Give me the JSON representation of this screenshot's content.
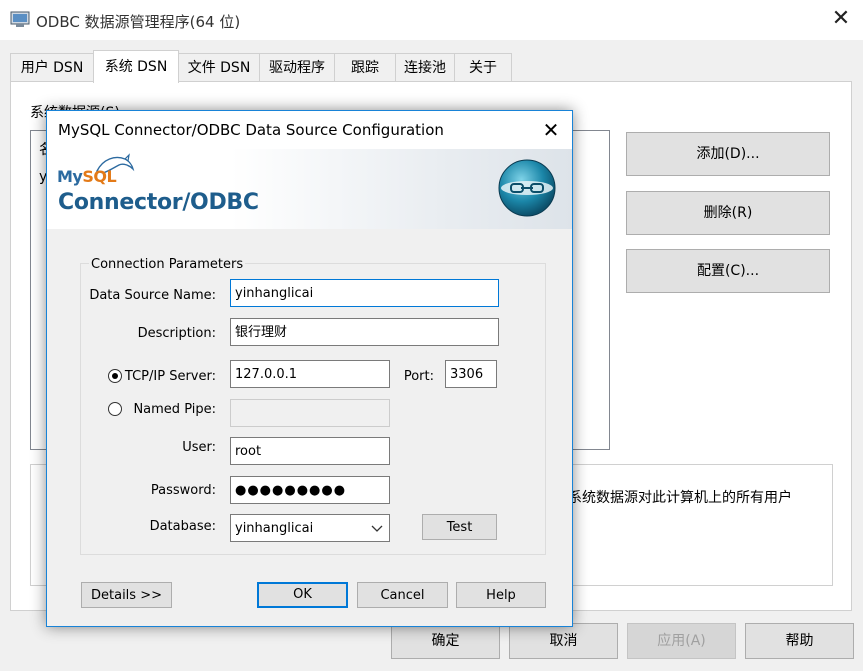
{
  "odbc": {
    "title": "ODBC 数据源管理程序(64 位)",
    "close_glyph": "✕",
    "tabs": [
      {
        "label": "用户 DSN"
      },
      {
        "label": "系统 DSN"
      },
      {
        "label": "文件 DSN"
      },
      {
        "label": "驱动程序"
      },
      {
        "label": "跟踪"
      },
      {
        "label": "连接池"
      },
      {
        "label": "关于"
      }
    ],
    "list_label": "系统数据源(S)",
    "list_fragments": [
      "名",
      "y"
    ],
    "side_buttons": {
      "add": "添加(D)...",
      "remove": "删除(R)",
      "configure": "配置(C)..."
    },
    "description_text": "系统数据源对此计算机上的所有用户",
    "bottom_buttons": {
      "ok": "确定",
      "cancel": "取消",
      "apply": "应用(A)",
      "help": "帮助"
    }
  },
  "dialog": {
    "title": "MySQL Connector/ODBC Data Source Configuration",
    "close_glyph": "✕",
    "banner": {
      "brand_my": "My",
      "brand_sql": "SQL",
      "product": "Connector/ODBC"
    },
    "group_label": "Connection Parameters",
    "fields": {
      "dsn_label": "Data Source Name:",
      "dsn_value": "yinhanglicai",
      "description_label": "Description:",
      "description_value": "银行理财",
      "tcp_label": "TCP/IP Server:",
      "tcp_value": "127.0.0.1",
      "port_label": "Port:",
      "port_value": "3306",
      "pipe_label": "Named Pipe:",
      "pipe_value": "",
      "user_label": "User:",
      "user_value": "root",
      "password_label": "Password:",
      "password_value": "●●●●●●●●●",
      "database_label": "Database:",
      "database_value": "yinhanglicai"
    },
    "buttons": {
      "test": "Test",
      "details": "Details >>",
      "ok": "OK",
      "cancel": "Cancel",
      "help": "Help"
    },
    "selected_connection": "tcp_ip"
  },
  "colors": {
    "accent": "#0078d7",
    "mysql_blue": "#2c6aa0",
    "mysql_orange": "#e37a18",
    "product_blue": "#1e5d8c"
  }
}
